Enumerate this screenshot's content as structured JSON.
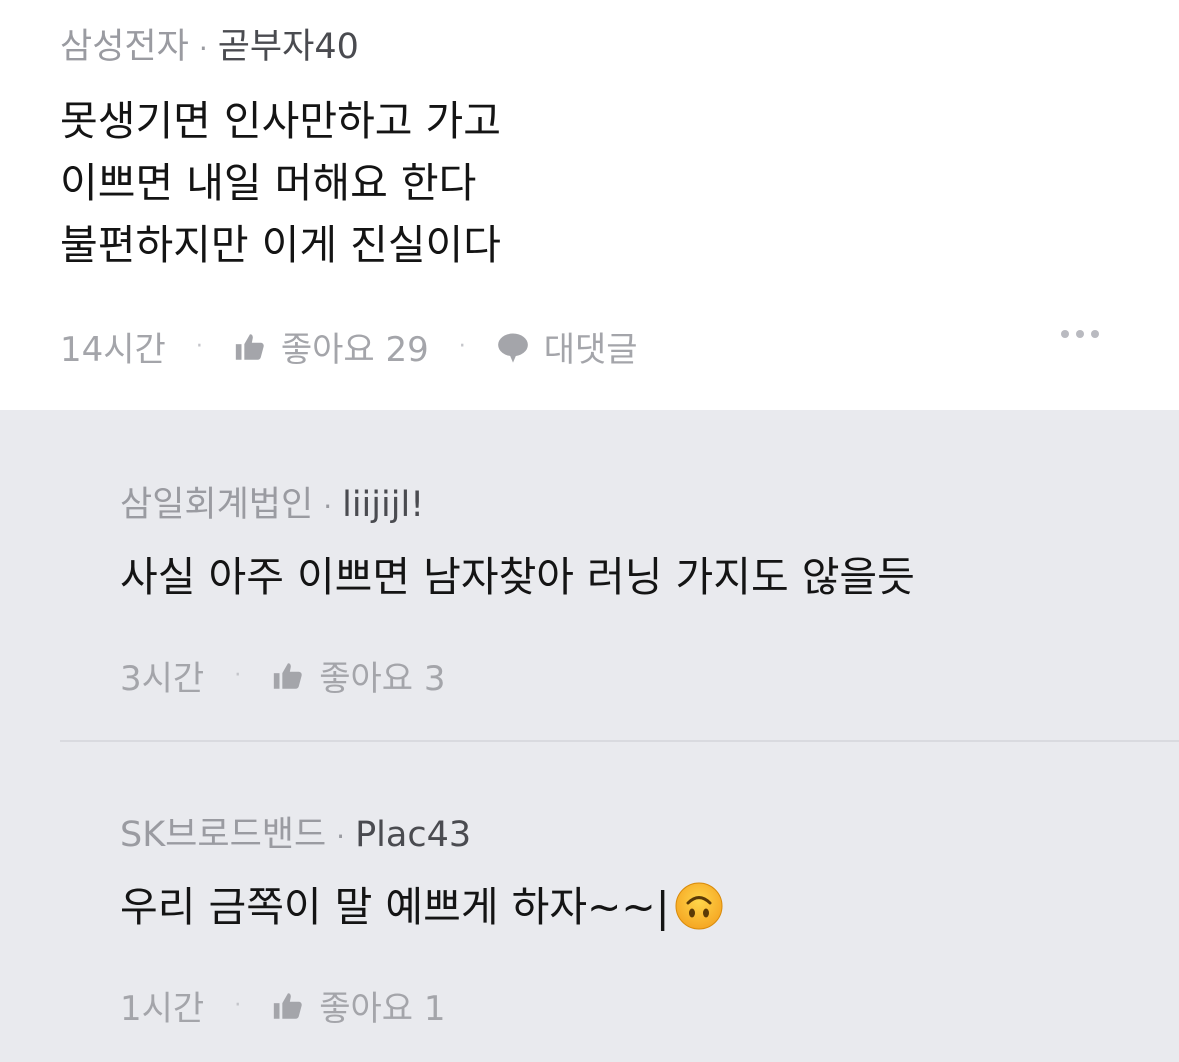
{
  "post": {
    "company": "삼성전자",
    "nickname": "곧부자40",
    "lines": [
      "못생기면 인사만하고 가고",
      "이쁘면 내일 머해요 한다",
      "불편하지만 이게 진실이다"
    ],
    "time": "14시간",
    "like_label": "좋아요 29",
    "reply_label": "대댓글"
  },
  "replies": [
    {
      "company": "삼일회계법인",
      "nickname": "liijijl!",
      "text": "사실 아주 이쁘면 남자찾아 러닝 가지도 않을듯",
      "time": "3시간",
      "like_label": "좋아요 3"
    },
    {
      "company": "SK브로드밴드",
      "nickname": "Plac43",
      "text": "우리 금쪽이 말 예쁘게 하자~~|",
      "emoji": "upside-down-face",
      "time": "1시간",
      "like_label": "좋아요 1"
    }
  ],
  "separator": "·",
  "colors": {
    "reply_background": "#e9eaee",
    "meta_gray": "#9a9ba1",
    "body": "#141414"
  }
}
